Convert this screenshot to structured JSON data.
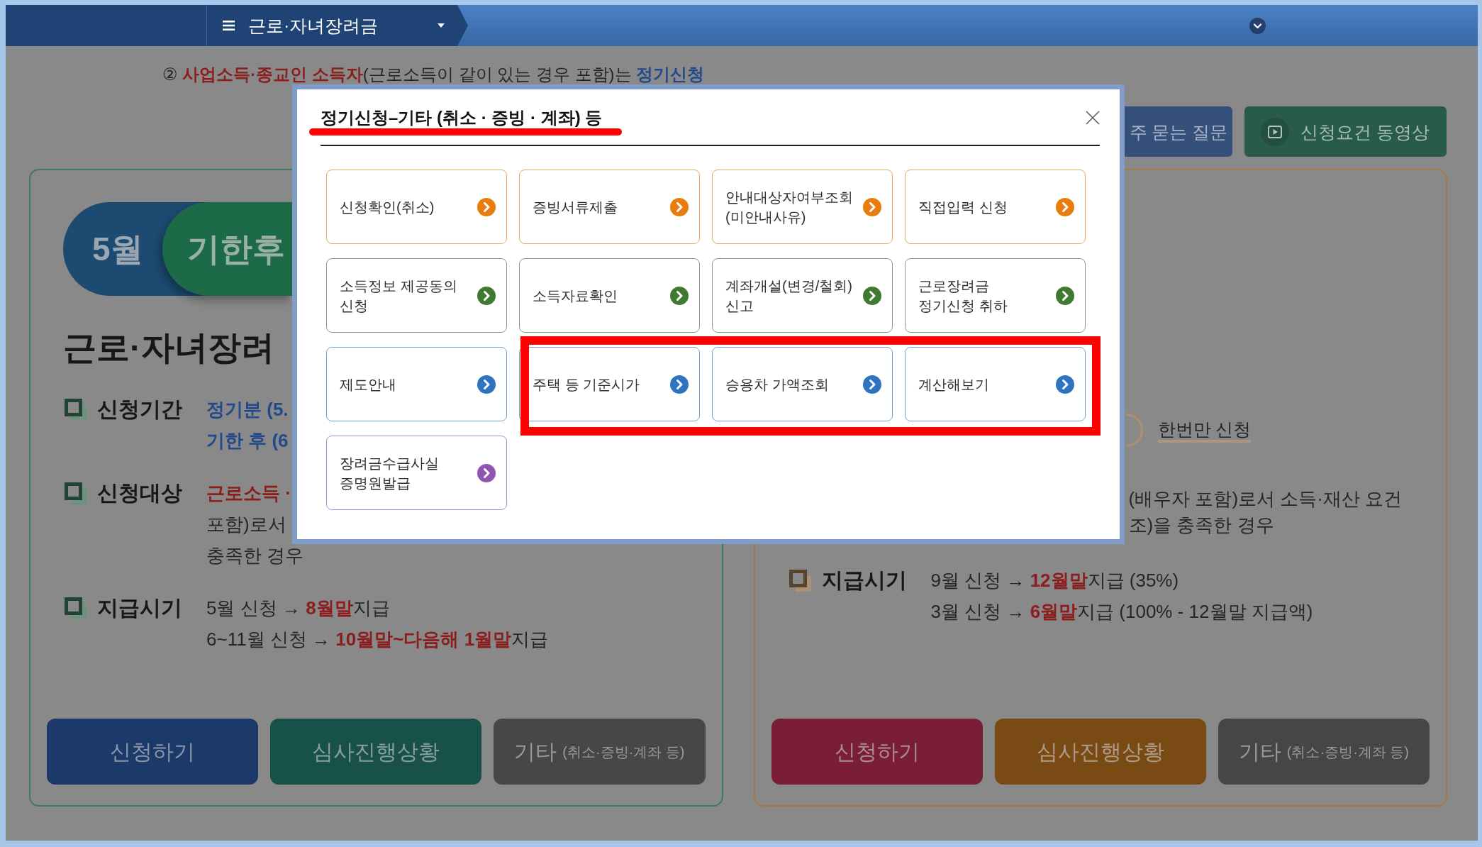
{
  "top_bar": {
    "menu_label": "근로·자녀장려금"
  },
  "notice": [
    {
      "text": "② ",
      "kind": "plain"
    },
    {
      "text": "사업소득·종교인 소득자",
      "kind": "emphasis"
    },
    {
      "text": "(근로소득이 같이 있는 경우 포함)는 ",
      "kind": "plain"
    },
    {
      "text": "정기신청",
      "kind": "accent"
    }
  ],
  "quick_links": [
    {
      "label": "주 묻는 질문",
      "kind": "faq"
    },
    {
      "label": "신청요건 동영상",
      "kind": "video"
    }
  ],
  "cards": [
    {
      "color": "#3f7a5c",
      "tabs": [
        {
          "label": "5월",
          "selected": false,
          "color": "#1c4a70"
        },
        {
          "label": "기한후",
          "selected": true,
          "color": "#1c6a48"
        }
      ],
      "title": "근로·자녀장려",
      "rows": [
        {
          "label": "신청기간",
          "lines": [
            [
              {
                "text": "정기분 (5.",
                "kind": "accent"
              }
            ],
            [
              {
                "text": "기한 후 (6",
                "kind": "accent"
              }
            ]
          ]
        },
        {
          "label": "신청대상",
          "lines": [
            [
              {
                "text": "근로소득 ·",
                "kind": "emphasis"
              }
            ],
            [
              {
                "text": "포함)로서",
                "kind": "plain"
              }
            ],
            [
              {
                "text": "충족한 경우",
                "kind": "plain"
              }
            ]
          ]
        },
        {
          "label": "지급시기",
          "lines": [
            [
              {
                "text": "5월 신청 → ",
                "kind": "plain"
              },
              {
                "text": "8월말",
                "kind": "emphasis"
              },
              {
                "text": "지급",
                "kind": "plain"
              }
            ],
            [
              {
                "text": "6~11월 신청 → ",
                "kind": "plain"
              },
              {
                "text": "10월말~다음해 1월말",
                "kind": "emphasis"
              },
              {
                "text": "지급",
                "kind": "plain"
              }
            ]
          ]
        }
      ],
      "buttons": [
        {
          "label": "신청하기",
          "color": "#1b3a6a"
        },
        {
          "label": "심사진행상황",
          "color": "#17514a"
        },
        {
          "label": "기타",
          "note": "(취소·증빙·계좌 등)",
          "color": "#484646"
        }
      ]
    },
    {
      "color": "#a37a50",
      "option": {
        "label": "한번만 신청"
      },
      "target_lines": [
        [
          {
            "text": "(배우자 포함)로서 소득·재산 요건",
            "kind": "plain"
          }
        ],
        [
          {
            "text": "조)을 충족한 경우",
            "kind": "plain"
          }
        ]
      ],
      "rows": [
        {
          "label": "지급시기",
          "lines": [
            [
              {
                "text": "9월 신청 → ",
                "kind": "plain"
              },
              {
                "text": "12월말",
                "kind": "emphasis"
              },
              {
                "text": "지급 (35%)",
                "kind": "plain"
              }
            ],
            [
              {
                "text": "3월 신청 → ",
                "kind": "plain"
              },
              {
                "text": "6월말",
                "kind": "emphasis"
              },
              {
                "text": "지급 (100% - 12월말 지급액)",
                "kind": "plain"
              }
            ]
          ]
        }
      ],
      "buttons": [
        {
          "label": "신청하기",
          "color": "#7a1e38"
        },
        {
          "label": "심사진행상황",
          "color": "#7a4a14"
        },
        {
          "label": "기타",
          "note": "(취소·증빙·계좌 등)",
          "color": "#474545"
        }
      ]
    }
  ],
  "modal": {
    "title": "정기신청–기타 (취소 · 증빙 · 계좌) 등",
    "title_underlined": true,
    "tiles": [
      {
        "label": "신청확인(취소)",
        "color": "#e67d0c",
        "highlighted": false
      },
      {
        "label": "증빙서류제출",
        "color": "#e67d0c",
        "highlighted": false
      },
      {
        "label": "안내대상자여부조회\n(미안내사유)",
        "color": "#e67d0c",
        "highlighted": false
      },
      {
        "label": "직접입력 신청",
        "color": "#e67d0c",
        "highlighted": false
      },
      {
        "label": "소득정보 제공동의\n신청",
        "color": "#3f7a33",
        "highlighted": false
      },
      {
        "label": "소득자료확인",
        "color": "#3f7a33",
        "highlighted": false
      },
      {
        "label": "계좌개설(변경/철회)\n신고",
        "color": "#3f7a33",
        "highlighted": false
      },
      {
        "label": "근로장려금\n정기신청 취하",
        "color": "#3f7a33",
        "highlighted": false
      },
      {
        "label": "제도안내",
        "color": "#2f72c0",
        "highlighted": false
      },
      {
        "label": "주택 등 기준시가",
        "color": "#2f72c0",
        "highlighted": true
      },
      {
        "label": "승용차 가액조회",
        "color": "#2f72c0",
        "highlighted": true
      },
      {
        "label": "계산해보기",
        "color": "#2f72c0",
        "highlighted": true
      },
      {
        "label": "장려금수급사실\n증명원발급",
        "color": "#8f55b3",
        "highlighted": false
      }
    ]
  }
}
